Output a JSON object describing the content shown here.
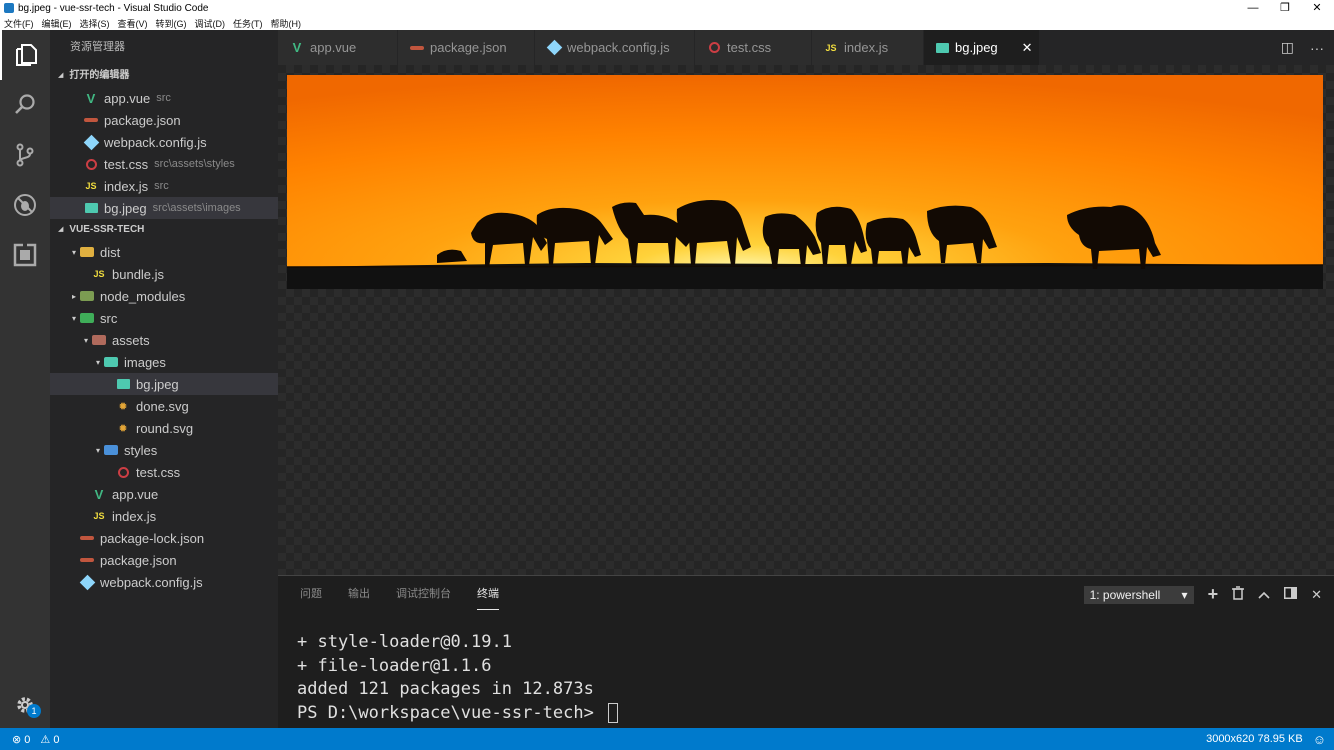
{
  "window": {
    "title": "bg.jpeg - vue-ssr-tech - Visual Studio Code",
    "minimize": "—",
    "maximize": "❐",
    "close": "✕"
  },
  "menu": [
    "文件(F)",
    "编辑(E)",
    "选择(S)",
    "查看(V)",
    "转到(G)",
    "调试(D)",
    "任务(T)",
    "帮助(H)"
  ],
  "activity": {
    "icons": [
      "files-icon",
      "search-icon",
      "source-control-icon",
      "debug-icon",
      "extensions-icon"
    ],
    "settings_badge": "1"
  },
  "sidebar": {
    "title": "资源管理器",
    "open_editors_header": "打开的编辑器",
    "open_editors": [
      {
        "name": "app.vue",
        "path": "src",
        "icon": "vue"
      },
      {
        "name": "package.json",
        "path": "",
        "icon": "json"
      },
      {
        "name": "webpack.config.js",
        "path": "",
        "icon": "webpack"
      },
      {
        "name": "test.css",
        "path": "src\\assets\\styles",
        "icon": "css"
      },
      {
        "name": "index.js",
        "path": "src",
        "icon": "js"
      },
      {
        "name": "bg.jpeg",
        "path": "src\\assets\\images",
        "icon": "img"
      }
    ],
    "project_header": "VUE-SSR-TECH",
    "tree": [
      {
        "name": "dist",
        "depth": 1,
        "icon": "folder-dist",
        "arrow": "▾"
      },
      {
        "name": "bundle.js",
        "depth": 2,
        "icon": "js",
        "arrow": ""
      },
      {
        "name": "node_modules",
        "depth": 1,
        "icon": "folder-node",
        "arrow": "▸"
      },
      {
        "name": "src",
        "depth": 1,
        "icon": "folder-src",
        "arrow": "▾"
      },
      {
        "name": "assets",
        "depth": 2,
        "icon": "folder-assets",
        "arrow": "▾"
      },
      {
        "name": "images",
        "depth": 3,
        "icon": "folder-images",
        "arrow": "▾"
      },
      {
        "name": "bg.jpeg",
        "depth": 4,
        "icon": "img",
        "arrow": ""
      },
      {
        "name": "done.svg",
        "depth": 4,
        "icon": "svg",
        "arrow": ""
      },
      {
        "name": "round.svg",
        "depth": 4,
        "icon": "svg",
        "arrow": ""
      },
      {
        "name": "styles",
        "depth": 3,
        "icon": "folder-styles",
        "arrow": "▾"
      },
      {
        "name": "test.css",
        "depth": 4,
        "icon": "css",
        "arrow": ""
      },
      {
        "name": "app.vue",
        "depth": 2,
        "icon": "vue",
        "arrow": ""
      },
      {
        "name": "index.js",
        "depth": 2,
        "icon": "js",
        "arrow": ""
      },
      {
        "name": "package-lock.json",
        "depth": 1,
        "icon": "json",
        "arrow": ""
      },
      {
        "name": "package.json",
        "depth": 1,
        "icon": "json",
        "arrow": ""
      },
      {
        "name": "webpack.config.js",
        "depth": 1,
        "icon": "webpack",
        "arrow": ""
      }
    ]
  },
  "tabs": [
    {
      "label": "app.vue",
      "icon": "vue"
    },
    {
      "label": "package.json",
      "icon": "json"
    },
    {
      "label": "webpack.config.js",
      "icon": "webpack"
    },
    {
      "label": "test.css",
      "icon": "css"
    },
    {
      "label": "index.js",
      "icon": "js"
    },
    {
      "label": "bg.jpeg",
      "icon": "img",
      "active": true
    }
  ],
  "editor_actions": {
    "split": "◫",
    "more": "···"
  },
  "panel": {
    "tabs": [
      "问题",
      "输出",
      "调试控制台",
      "终端"
    ],
    "active_tab": "终端",
    "terminal_select": "1: powershell",
    "terminal_lines": [
      "+ style-loader@0.19.1",
      "+ file-loader@1.1.6",
      "added 121 packages in 12.873s",
      "PS D:\\workspace\\vue-ssr-tech> "
    ]
  },
  "status": {
    "errors": "0",
    "warnings": "0",
    "image_info": "3000x620 78.95 KB"
  },
  "colors": {
    "accent": "#007acc",
    "sunset_top": "#ff7a00",
    "sunset_glow": "#ffd23a"
  }
}
